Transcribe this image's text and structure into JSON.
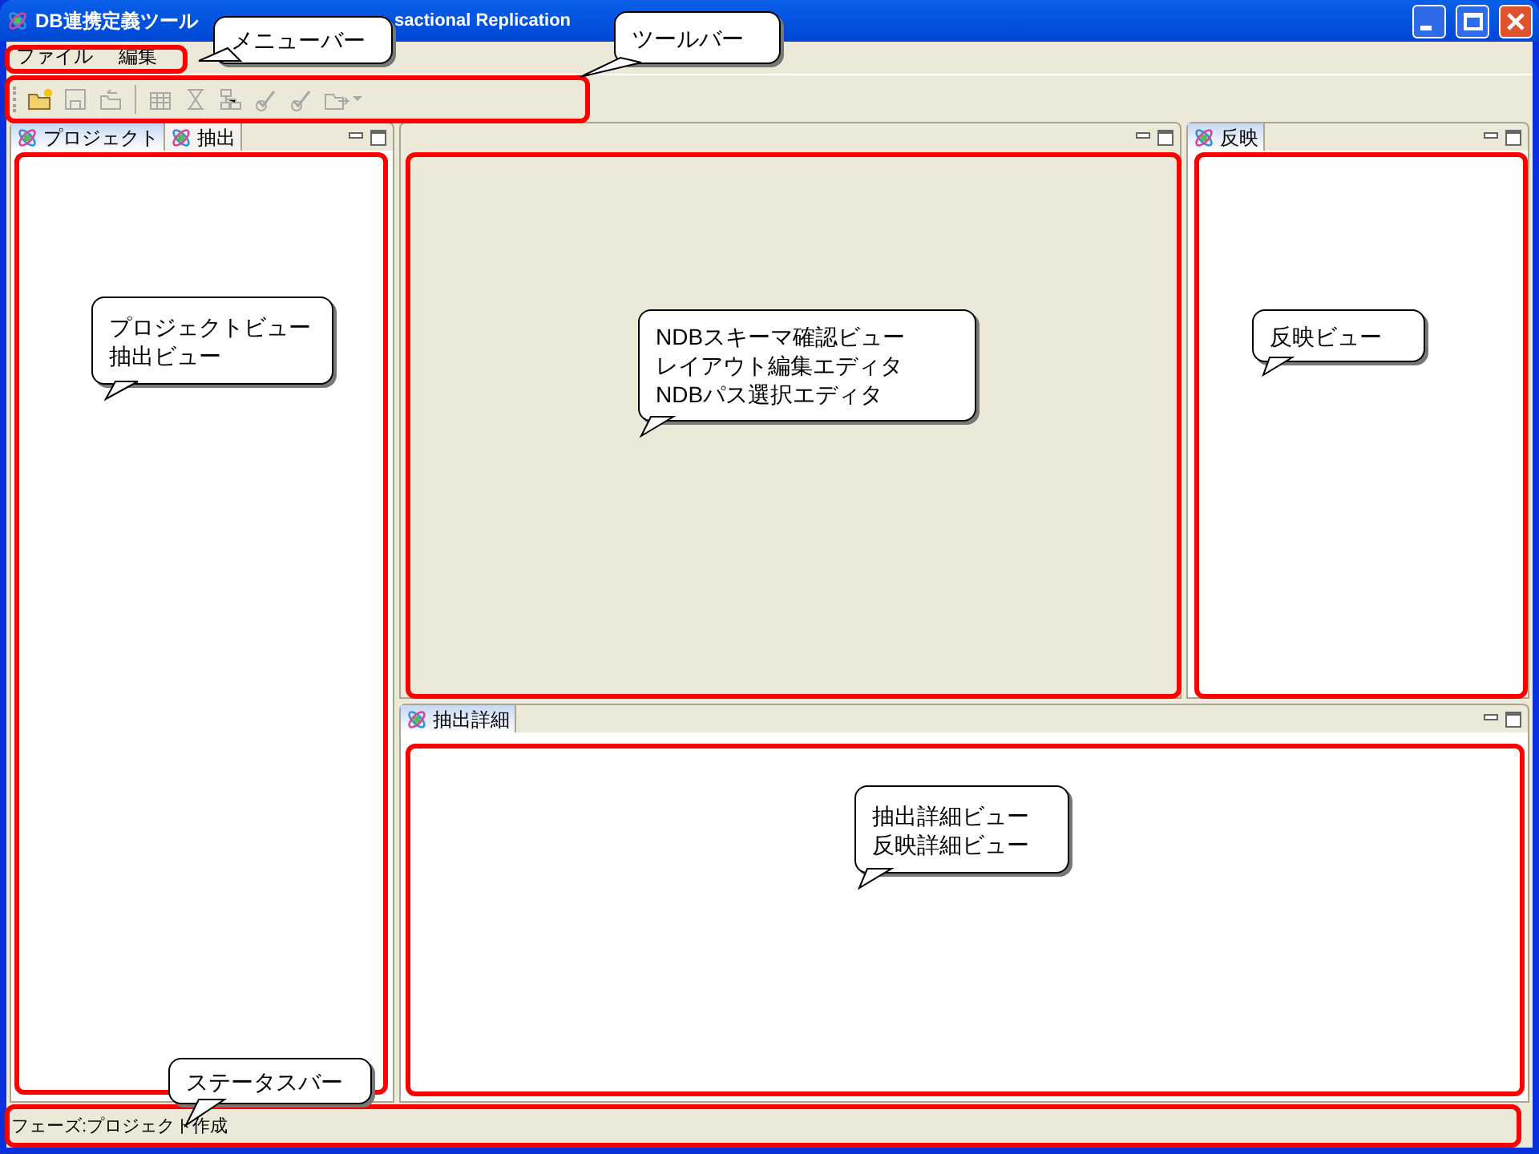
{
  "window": {
    "title_parts": [
      "DB連携定義ツール",
      "sactional Replication"
    ]
  },
  "menu": [
    "ファイル",
    "編集"
  ],
  "toolbar": [
    {
      "kind": "folder",
      "disabled": false
    },
    {
      "kind": "save",
      "disabled": true
    },
    {
      "kind": "back",
      "disabled": true
    },
    {
      "kind": "separator"
    },
    {
      "kind": "grid",
      "disabled": true
    },
    {
      "kind": "hourglass",
      "disabled": true
    },
    {
      "kind": "tree",
      "disabled": true
    },
    {
      "kind": "check",
      "disabled": true
    },
    {
      "kind": "check",
      "disabled": true
    },
    {
      "kind": "export",
      "disabled": true
    }
  ],
  "left_panel": {
    "tabs": [
      {
        "label": "プロジェクト",
        "selected": true
      },
      {
        "label": "抽出",
        "selected": false
      }
    ]
  },
  "right_panel": {
    "tabs": [
      {
        "label": "反映",
        "selected": true
      }
    ]
  },
  "bottom_panel": {
    "tabs": [
      {
        "label": "抽出詳細",
        "selected": true
      }
    ]
  },
  "status_bar": {
    "text": "フェーズ:プロジェクト作成"
  },
  "annotations": [
    {
      "kind": "menu_bar",
      "lines": [
        "メニューバー"
      ]
    },
    {
      "kind": "tool_bar",
      "lines": [
        "ツールバー"
      ]
    },
    {
      "kind": "left_view",
      "lines": [
        "プロジェクトビュー",
        "抽出ビュー"
      ]
    },
    {
      "kind": "editor",
      "lines": [
        "NDBスキーマ確認ビュー",
        "レイアウト編集エディタ",
        "NDBパス選択エディタ"
      ]
    },
    {
      "kind": "right_view",
      "lines": [
        "反映ビュー"
      ]
    },
    {
      "kind": "bottom_view",
      "lines": [
        "抽出詳細ビュー",
        "反映詳細ビュー"
      ]
    },
    {
      "kind": "status_bar",
      "lines": [
        "ステータスバー"
      ]
    }
  ]
}
